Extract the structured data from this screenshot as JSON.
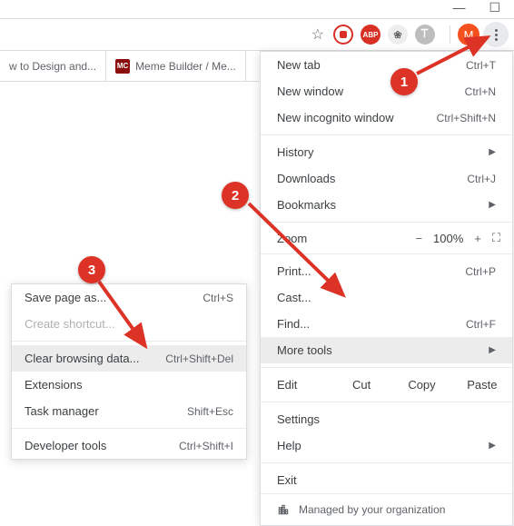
{
  "window_controls": {
    "min": "—",
    "max": "☐",
    "close": "✕"
  },
  "toolbar": {
    "star": "☆",
    "ext_icons": [
      {
        "bg": "#fff",
        "border": "#d93025",
        "txt": "",
        "inner_circle": "#d93025"
      },
      {
        "bg": "#d93025",
        "txt": "ABP"
      },
      {
        "bg": "#e0e0e0",
        "txt": "❀",
        "fg": "#555"
      },
      {
        "bg": "#bdbdbd",
        "txt": "𐊗",
        "fg": "#fff"
      }
    ],
    "avatar_initial": "M"
  },
  "tabs": [
    {
      "label": "w to Design and..."
    },
    {
      "favicon": "MC",
      "label": "Meme Builder / Me..."
    }
  ],
  "menu": {
    "new_tab": {
      "label": "New tab",
      "shortcut": "Ctrl+T"
    },
    "new_window": {
      "label": "New window",
      "shortcut": "Ctrl+N"
    },
    "incognito": {
      "label": "New incognito window",
      "shortcut": "Ctrl+Shift+N"
    },
    "history": {
      "label": "History"
    },
    "downloads": {
      "label": "Downloads",
      "shortcut": "Ctrl+J"
    },
    "bookmarks": {
      "label": "Bookmarks"
    },
    "zoom": {
      "label": "Zoom",
      "pct": "100%"
    },
    "print": {
      "label": "Print...",
      "shortcut": "Ctrl+P"
    },
    "cast": {
      "label": "Cast..."
    },
    "find": {
      "label": "Find...",
      "shortcut": "Ctrl+F"
    },
    "more_tools": {
      "label": "More tools"
    },
    "edit": {
      "label": "Edit",
      "cut": "Cut",
      "copy": "Copy",
      "paste": "Paste"
    },
    "settings": {
      "label": "Settings"
    },
    "help": {
      "label": "Help"
    },
    "exit": {
      "label": "Exit"
    },
    "managed": "Managed by your organization"
  },
  "submenu": {
    "save_page": {
      "label": "Save page as...",
      "shortcut": "Ctrl+S"
    },
    "create_shortcut": {
      "label": "Create shortcut..."
    },
    "clear_data": {
      "label": "Clear browsing data...",
      "shortcut": "Ctrl+Shift+Del"
    },
    "extensions": {
      "label": "Extensions"
    },
    "task_mgr": {
      "label": "Task manager",
      "shortcut": "Shift+Esc"
    },
    "dev_tools": {
      "label": "Developer tools",
      "shortcut": "Ctrl+Shift+I"
    }
  },
  "annotations": {
    "b1": "1",
    "b2": "2",
    "b3": "3"
  }
}
